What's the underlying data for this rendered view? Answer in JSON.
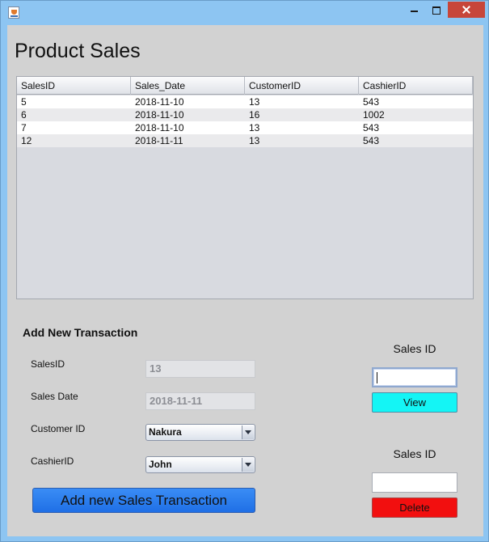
{
  "window": {
    "title": "",
    "icon": "java-icon"
  },
  "page": {
    "title": "Product Sales"
  },
  "table": {
    "columns": [
      "SalesID",
      "Sales_Date",
      "CustomerID",
      "CashierID"
    ],
    "rows": [
      [
        "5",
        "2018-11-10",
        "13",
        "543"
      ],
      [
        "6",
        "2018-11-10",
        "16",
        "1002"
      ],
      [
        "7",
        "2018-11-10",
        "13",
        "543"
      ],
      [
        "12",
        "2018-11-11",
        "13",
        "543"
      ]
    ]
  },
  "form": {
    "title": "Add New Transaction",
    "sales_id_label": "SalesID",
    "sales_id_value": "13",
    "sales_date_label": "Sales Date",
    "sales_date_value": "2018-11-11",
    "customer_label": "Customer ID",
    "customer_selected": "Nakura",
    "cashier_label": "CashierID",
    "cashier_selected": "John",
    "submit_label": "Add new Sales Transaction"
  },
  "view_panel": {
    "label": "Sales ID",
    "input_value": "",
    "button_label": "View",
    "button_color": "#14f5f5"
  },
  "delete_panel": {
    "label": "Sales ID",
    "input_value": "",
    "button_label": "Delete",
    "button_color": "#f20f0f"
  },
  "colors": {
    "titlebar": "#8dc5f2",
    "content_bg": "#d2d2d2",
    "add_button": "#1f6fe6",
    "close_button": "#c7463a"
  }
}
